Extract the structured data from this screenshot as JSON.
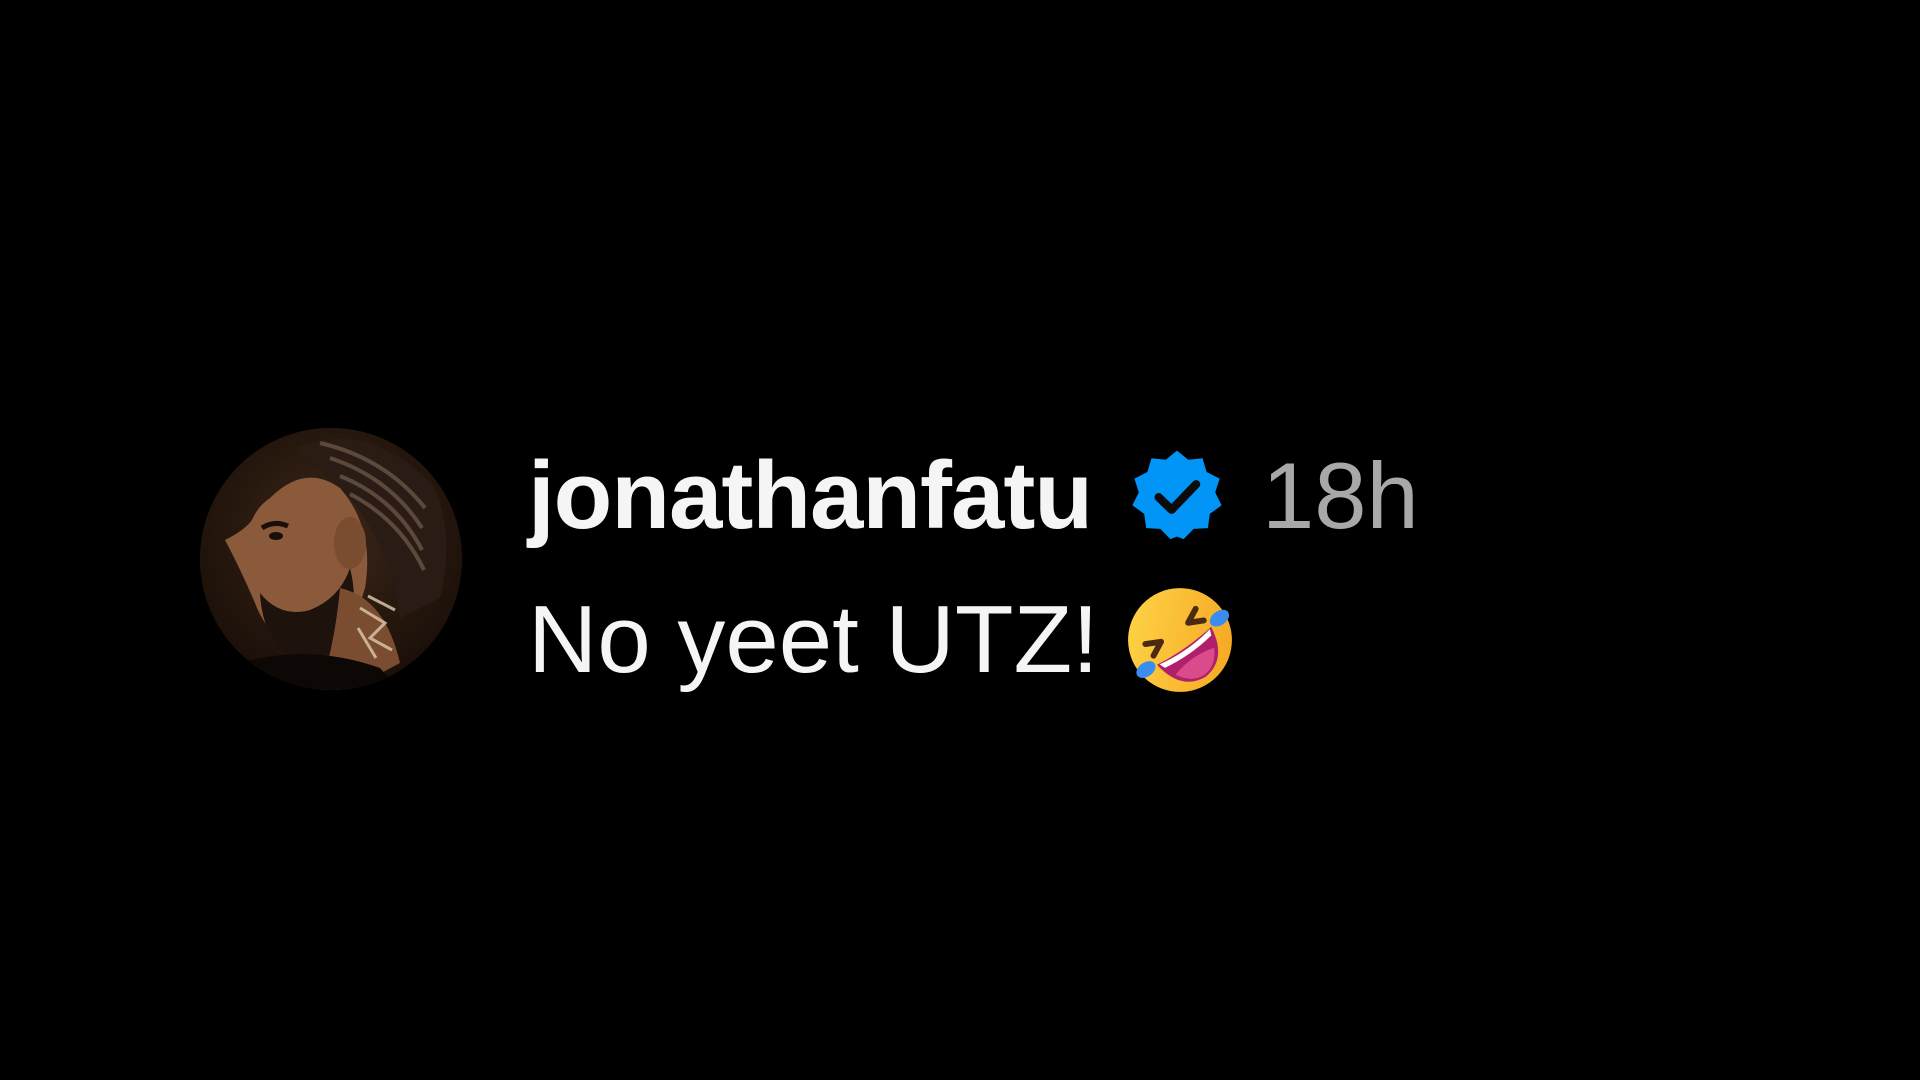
{
  "comment": {
    "username": "jonathanfatu",
    "verified_icon": "verified-badge-icon",
    "timestamp": "18h",
    "text": "No yeet UTZ!",
    "emoji": "rolling-on-floor-laughing-emoji"
  },
  "colors": {
    "background": "#000000",
    "username": "#f5f5f5",
    "timestamp": "#a8a8a8",
    "verified_badge": "#0095f6"
  }
}
